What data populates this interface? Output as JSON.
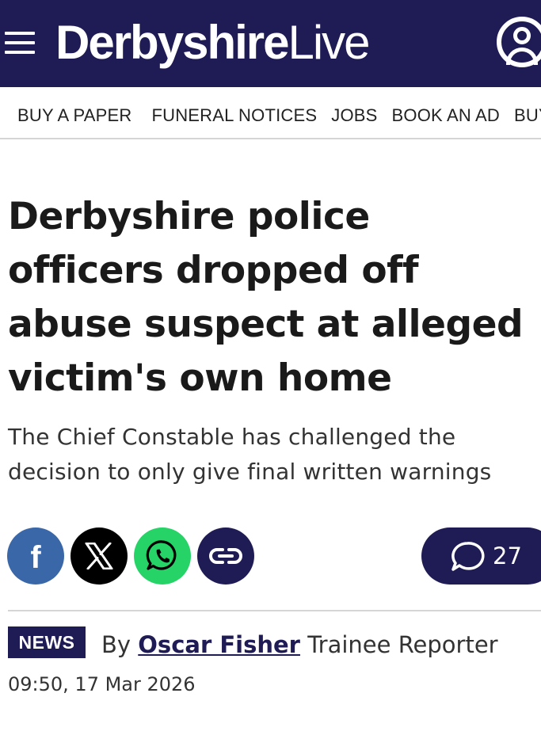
{
  "header": {
    "logo_main": "Derbyshire",
    "logo_sub": "Live",
    "menu_icon": "hamburger-menu-icon",
    "account_icon": "user-account-icon",
    "background_color": "#1f1b54"
  },
  "nav": {
    "items": [
      {
        "label": "BUY A PAPER"
      },
      {
        "label": "FUNERAL NOTICES"
      },
      {
        "label": "JOBS"
      },
      {
        "label": "BOOK AN AD"
      },
      {
        "label": "BUY"
      }
    ]
  },
  "article": {
    "headline": "Derbyshire police officers dropped off abuse suspect at alleged victim's own home",
    "standfirst": "The Chief Constable has challenged the decision to only give final written warnings",
    "category": "NEWS",
    "byline_prefix": "By",
    "author": "Oscar Fisher",
    "author_role": "Trainee Reporter",
    "timestamp": "09:50, 17 Mar 2026"
  },
  "share": {
    "buttons": [
      {
        "icon": "facebook-icon",
        "color": "#3a67a8"
      },
      {
        "icon": "x-icon",
        "color": "#000000"
      },
      {
        "icon": "whatsapp-icon",
        "color": "#25d366"
      },
      {
        "icon": "link-icon",
        "color": "#1f1b54"
      }
    ],
    "comments_count": "27",
    "comments_icon": "comment-bubble-icon"
  }
}
